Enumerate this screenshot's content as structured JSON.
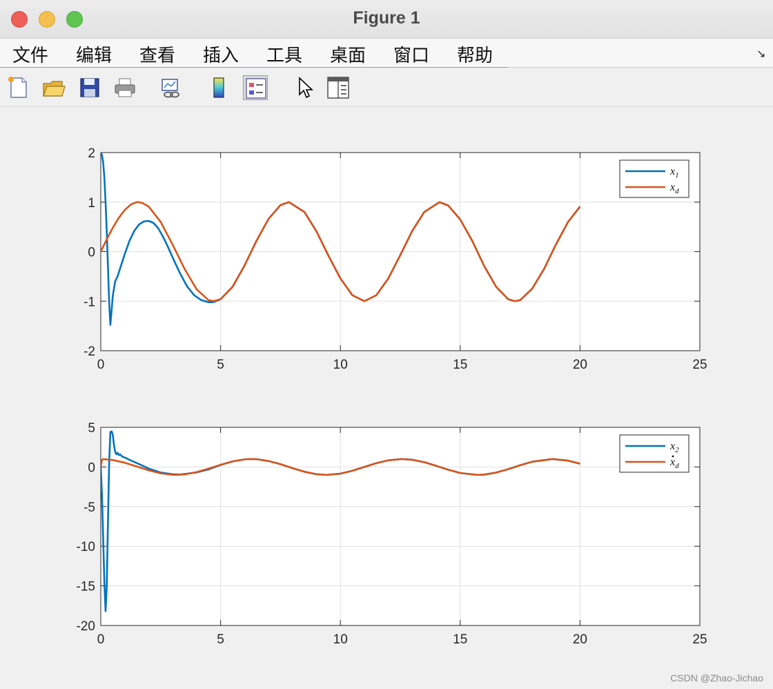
{
  "window": {
    "title": "Figure 1"
  },
  "menu": [
    "文件",
    "编辑",
    "查看",
    "插入",
    "工具",
    "桌面",
    "窗口",
    "帮助"
  ],
  "menu_collapse_glyph": "↘",
  "toolbar": [
    "new-figure-icon",
    "open-file-icon",
    "save-icon",
    "print-icon",
    "link-plot-icon",
    "colorbar-icon",
    "legend-icon",
    "edit-plot-cursor-icon",
    "property-editor-icon"
  ],
  "watermark": "CSDN @Zhao-Jichao",
  "colors": {
    "series1": "#0072bd",
    "series2": "#d95319",
    "grid": "#dfdfdf",
    "axis": "#262626"
  },
  "chart_data": [
    {
      "type": "line",
      "xlim": [
        0,
        25
      ],
      "ylim": [
        -2,
        2
      ],
      "xticks": [
        0,
        5,
        10,
        15,
        20,
        25
      ],
      "yticks": [
        2,
        1,
        0,
        -1,
        -2
      ],
      "grid": true,
      "legend_position": "top-right",
      "series": [
        {
          "name": "x1",
          "color": "#0072bd",
          "x": [
            0,
            0.05,
            0.1,
            0.15,
            0.2,
            0.25,
            0.3,
            0.35,
            0.4,
            0.45,
            0.5,
            0.6,
            0.7,
            0.8,
            1.0,
            1.2,
            1.4,
            1.6,
            1.8,
            2.0,
            2.2,
            2.4,
            2.6,
            2.8,
            3.0,
            3.3,
            3.6,
            3.9,
            4.2,
            4.5,
            4.7,
            5.0,
            5.5,
            6.0,
            6.5,
            7.0,
            7.5,
            7.854,
            8.5,
            9.0,
            9.5,
            10.0,
            10.5,
            11.0,
            11.5,
            12.0,
            12.5,
            13.0,
            13.5,
            14.137,
            14.5,
            15.0,
            15.5,
            16.0,
            16.5,
            17.0,
            17.28,
            17.5,
            18.0,
            18.5,
            19.0,
            19.5,
            20.0
          ],
          "y": [
            2.0,
            1.95,
            1.8,
            1.5,
            1.0,
            0.4,
            -0.3,
            -1.0,
            -1.48,
            -1.2,
            -0.9,
            -0.6,
            -0.5,
            -0.35,
            -0.05,
            0.22,
            0.42,
            0.55,
            0.61,
            0.62,
            0.58,
            0.47,
            0.3,
            0.1,
            -0.12,
            -0.43,
            -0.7,
            -0.88,
            -0.98,
            -1.02,
            -1.02,
            -0.96,
            -0.71,
            -0.28,
            0.22,
            0.66,
            0.94,
            1.0,
            0.8,
            0.41,
            -0.08,
            -0.54,
            -0.88,
            -1.0,
            -0.88,
            -0.54,
            -0.07,
            0.42,
            0.8,
            1.0,
            0.93,
            0.65,
            0.22,
            -0.29,
            -0.71,
            -0.96,
            -1.0,
            -0.98,
            -0.75,
            -0.35,
            0.15,
            0.6,
            0.91
          ]
        },
        {
          "name": "xd",
          "color": "#d95319",
          "x": [
            0,
            0.25,
            0.5,
            0.75,
            1.0,
            1.25,
            1.5,
            1.571,
            1.75,
            2.0,
            2.5,
            3.0,
            3.5,
            4.0,
            4.5,
            4.712,
            5.0,
            5.5,
            6.0,
            6.5,
            7.0,
            7.5,
            7.854,
            8.5,
            9.0,
            9.5,
            10.0,
            10.5,
            11.0,
            11.5,
            12.0,
            12.5,
            13.0,
            13.5,
            14.137,
            14.5,
            15.0,
            15.5,
            16.0,
            16.5,
            17.0,
            17.28,
            17.5,
            18.0,
            18.5,
            19.0,
            19.5,
            20.0
          ],
          "y": [
            0.0,
            0.25,
            0.48,
            0.68,
            0.84,
            0.95,
            1.0,
            1.0,
            0.98,
            0.91,
            0.6,
            0.14,
            -0.35,
            -0.76,
            -0.98,
            -1.0,
            -0.96,
            -0.71,
            -0.28,
            0.22,
            0.66,
            0.94,
            1.0,
            0.8,
            0.41,
            -0.08,
            -0.54,
            -0.88,
            -1.0,
            -0.88,
            -0.54,
            -0.07,
            0.42,
            0.8,
            1.0,
            0.93,
            0.65,
            0.22,
            -0.29,
            -0.71,
            -0.96,
            -1.0,
            -0.98,
            -0.75,
            -0.35,
            0.15,
            0.6,
            0.91
          ]
        }
      ]
    },
    {
      "type": "line",
      "xlim": [
        0,
        25
      ],
      "ylim": [
        -20,
        5
      ],
      "xticks": [
        0,
        5,
        10,
        15,
        20,
        25
      ],
      "yticks": [
        5,
        0,
        -5,
        -10,
        -15,
        -20
      ],
      "grid": true,
      "legend_position": "top-right",
      "series": [
        {
          "name": "x2",
          "color": "#0072bd",
          "x": [
            0,
            0.05,
            0.1,
            0.15,
            0.2,
            0.25,
            0.3,
            0.35,
            0.4,
            0.45,
            0.5,
            0.55,
            0.6,
            0.65,
            0.7,
            0.75,
            0.8,
            0.9,
            1.0,
            1.2,
            1.5,
            2.0,
            2.5,
            3.0,
            3.3,
            3.6,
            4.0,
            4.5,
            5.0,
            5.5,
            6.0,
            6.283,
            6.5,
            7.0,
            7.5,
            8.0,
            8.5,
            9.0,
            9.42,
            10.0,
            10.5,
            11.0,
            11.5,
            12.0,
            12.57,
            13.0,
            13.5,
            14.0,
            14.5,
            15.0,
            15.71,
            16.0,
            16.5,
            17.0,
            17.5,
            18.0,
            18.85,
            19.5,
            20.0
          ],
          "y": [
            0.0,
            -3.5,
            -9.0,
            -14.5,
            -18.2,
            -15.0,
            -7.0,
            0.5,
            4.4,
            4.5,
            4.1,
            2.8,
            1.9,
            1.6,
            1.8,
            1.5,
            1.6,
            1.3,
            1.2,
            0.9,
            0.5,
            -0.2,
            -0.7,
            -0.92,
            -0.95,
            -0.85,
            -0.68,
            -0.31,
            0.25,
            0.7,
            0.96,
            1.0,
            0.98,
            0.75,
            0.35,
            -0.15,
            -0.6,
            -0.91,
            -1.0,
            -0.84,
            -0.48,
            -0.0,
            0.48,
            0.84,
            1.0,
            0.91,
            0.6,
            0.14,
            -0.35,
            -0.76,
            -1.0,
            -0.96,
            -0.71,
            -0.28,
            0.22,
            0.66,
            1.0,
            0.8,
            0.41
          ]
        },
        {
          "name": "xd_dot",
          "color": "#d95319",
          "x": [
            0,
            0.05,
            0.1,
            0.5,
            1.0,
            1.5,
            2.0,
            2.5,
            3.0,
            3.1416,
            3.5,
            4.0,
            4.5,
            5.0,
            5.5,
            6.0,
            6.283,
            6.5,
            7.0,
            7.5,
            8.0,
            8.5,
            9.0,
            9.42,
            10.0,
            10.5,
            11.0,
            11.5,
            12.0,
            12.57,
            13.0,
            13.5,
            14.0,
            14.5,
            15.0,
            15.71,
            16.0,
            16.5,
            17.0,
            17.5,
            18.0,
            18.85,
            19.5,
            20.0
          ],
          "y": [
            0.0,
            0.9,
            0.99,
            0.88,
            0.54,
            0.07,
            -0.42,
            -0.8,
            -0.99,
            -1.0,
            -0.94,
            -0.65,
            -0.21,
            0.28,
            0.71,
            0.96,
            1.0,
            0.98,
            0.75,
            0.35,
            -0.15,
            -0.6,
            -0.91,
            -1.0,
            -0.84,
            -0.48,
            -0.0,
            0.48,
            0.84,
            1.0,
            0.91,
            0.6,
            0.14,
            -0.35,
            -0.76,
            -1.0,
            -0.96,
            -0.71,
            -0.28,
            0.22,
            0.66,
            1.0,
            0.8,
            0.41
          ]
        }
      ]
    }
  ]
}
